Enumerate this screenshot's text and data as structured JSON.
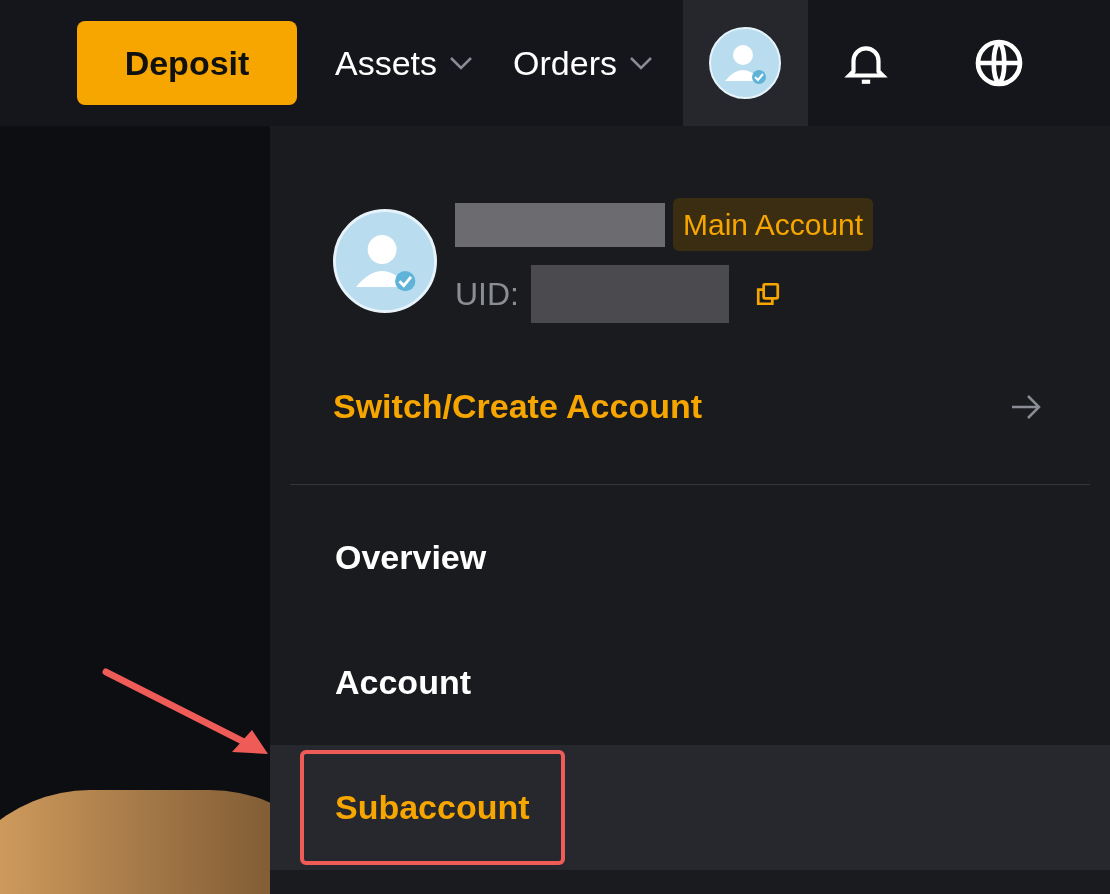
{
  "topbar": {
    "deposit": "Deposit",
    "menus": [
      {
        "label": "Assets"
      },
      {
        "label": "Orders"
      }
    ],
    "avatar_selected": true
  },
  "profile": {
    "badge": "Main Account",
    "uid_label": "UID:"
  },
  "switch_link": "Switch/Create Account",
  "menu_items": [
    {
      "label": "Overview",
      "selected": false,
      "annotated": false
    },
    {
      "label": "Account",
      "selected": false,
      "annotated": false
    },
    {
      "label": "Subaccount",
      "selected": true,
      "annotated": true
    }
  ]
}
